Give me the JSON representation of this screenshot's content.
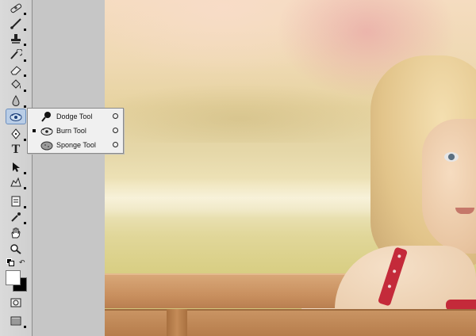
{
  "toolbox": {
    "tools": [
      "healing-brush-icon",
      "brush-icon",
      "clone-stamp-icon",
      "history-brush-icon",
      "eraser-icon",
      "paint-bucket-icon",
      "blur-icon",
      "dodge-icon",
      "pen-icon",
      "type-icon",
      "path-selection-icon",
      "custom-shape-icon",
      "notes-icon",
      "eyedropper-icon",
      "hand-icon",
      "zoom-icon",
      "quick-mask-icon",
      "screen-mode-icon"
    ],
    "type_glyph": "T",
    "foreground_color": "#ffffff",
    "background_color": "#000000"
  },
  "flyout": {
    "items": [
      {
        "label": "Dodge Tool",
        "icon": "dodge-tool-icon",
        "selected": false,
        "shortcut": "O"
      },
      {
        "label": "Burn Tool",
        "icon": "burn-tool-icon",
        "selected": true,
        "shortcut": "O"
      },
      {
        "label": "Sponge Tool",
        "icon": "sponge-tool-icon",
        "selected": false,
        "shortcut": "O"
      }
    ]
  },
  "colors": {
    "active_tool_bg": "#b9cde6",
    "strap": "#c42a3a"
  }
}
